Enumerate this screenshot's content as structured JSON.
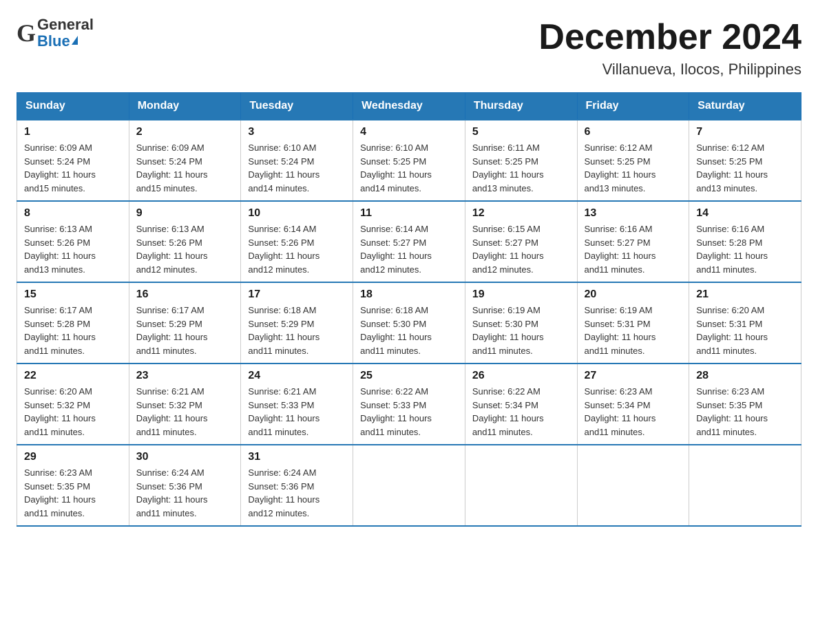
{
  "header": {
    "logo_general": "General",
    "logo_blue": "Blue",
    "month_title": "December 2024",
    "location": "Villanueva, Ilocos, Philippines"
  },
  "weekdays": [
    "Sunday",
    "Monday",
    "Tuesday",
    "Wednesday",
    "Thursday",
    "Friday",
    "Saturday"
  ],
  "weeks": [
    [
      {
        "day": "1",
        "sunrise": "6:09 AM",
        "sunset": "5:24 PM",
        "daylight": "11 hours and 15 minutes."
      },
      {
        "day": "2",
        "sunrise": "6:09 AM",
        "sunset": "5:24 PM",
        "daylight": "11 hours and 15 minutes."
      },
      {
        "day": "3",
        "sunrise": "6:10 AM",
        "sunset": "5:24 PM",
        "daylight": "11 hours and 14 minutes."
      },
      {
        "day": "4",
        "sunrise": "6:10 AM",
        "sunset": "5:25 PM",
        "daylight": "11 hours and 14 minutes."
      },
      {
        "day": "5",
        "sunrise": "6:11 AM",
        "sunset": "5:25 PM",
        "daylight": "11 hours and 13 minutes."
      },
      {
        "day": "6",
        "sunrise": "6:12 AM",
        "sunset": "5:25 PM",
        "daylight": "11 hours and 13 minutes."
      },
      {
        "day": "7",
        "sunrise": "6:12 AM",
        "sunset": "5:25 PM",
        "daylight": "11 hours and 13 minutes."
      }
    ],
    [
      {
        "day": "8",
        "sunrise": "6:13 AM",
        "sunset": "5:26 PM",
        "daylight": "11 hours and 13 minutes."
      },
      {
        "day": "9",
        "sunrise": "6:13 AM",
        "sunset": "5:26 PM",
        "daylight": "11 hours and 12 minutes."
      },
      {
        "day": "10",
        "sunrise": "6:14 AM",
        "sunset": "5:26 PM",
        "daylight": "11 hours and 12 minutes."
      },
      {
        "day": "11",
        "sunrise": "6:14 AM",
        "sunset": "5:27 PM",
        "daylight": "11 hours and 12 minutes."
      },
      {
        "day": "12",
        "sunrise": "6:15 AM",
        "sunset": "5:27 PM",
        "daylight": "11 hours and 12 minutes."
      },
      {
        "day": "13",
        "sunrise": "6:16 AM",
        "sunset": "5:27 PM",
        "daylight": "11 hours and 11 minutes."
      },
      {
        "day": "14",
        "sunrise": "6:16 AM",
        "sunset": "5:28 PM",
        "daylight": "11 hours and 11 minutes."
      }
    ],
    [
      {
        "day": "15",
        "sunrise": "6:17 AM",
        "sunset": "5:28 PM",
        "daylight": "11 hours and 11 minutes."
      },
      {
        "day": "16",
        "sunrise": "6:17 AM",
        "sunset": "5:29 PM",
        "daylight": "11 hours and 11 minutes."
      },
      {
        "day": "17",
        "sunrise": "6:18 AM",
        "sunset": "5:29 PM",
        "daylight": "11 hours and 11 minutes."
      },
      {
        "day": "18",
        "sunrise": "6:18 AM",
        "sunset": "5:30 PM",
        "daylight": "11 hours and 11 minutes."
      },
      {
        "day": "19",
        "sunrise": "6:19 AM",
        "sunset": "5:30 PM",
        "daylight": "11 hours and 11 minutes."
      },
      {
        "day": "20",
        "sunrise": "6:19 AM",
        "sunset": "5:31 PM",
        "daylight": "11 hours and 11 minutes."
      },
      {
        "day": "21",
        "sunrise": "6:20 AM",
        "sunset": "5:31 PM",
        "daylight": "11 hours and 11 minutes."
      }
    ],
    [
      {
        "day": "22",
        "sunrise": "6:20 AM",
        "sunset": "5:32 PM",
        "daylight": "11 hours and 11 minutes."
      },
      {
        "day": "23",
        "sunrise": "6:21 AM",
        "sunset": "5:32 PM",
        "daylight": "11 hours and 11 minutes."
      },
      {
        "day": "24",
        "sunrise": "6:21 AM",
        "sunset": "5:33 PM",
        "daylight": "11 hours and 11 minutes."
      },
      {
        "day": "25",
        "sunrise": "6:22 AM",
        "sunset": "5:33 PM",
        "daylight": "11 hours and 11 minutes."
      },
      {
        "day": "26",
        "sunrise": "6:22 AM",
        "sunset": "5:34 PM",
        "daylight": "11 hours and 11 minutes."
      },
      {
        "day": "27",
        "sunrise": "6:23 AM",
        "sunset": "5:34 PM",
        "daylight": "11 hours and 11 minutes."
      },
      {
        "day": "28",
        "sunrise": "6:23 AM",
        "sunset": "5:35 PM",
        "daylight": "11 hours and 11 minutes."
      }
    ],
    [
      {
        "day": "29",
        "sunrise": "6:23 AM",
        "sunset": "5:35 PM",
        "daylight": "11 hours and 11 minutes."
      },
      {
        "day": "30",
        "sunrise": "6:24 AM",
        "sunset": "5:36 PM",
        "daylight": "11 hours and 11 minutes."
      },
      {
        "day": "31",
        "sunrise": "6:24 AM",
        "sunset": "5:36 PM",
        "daylight": "11 hours and 12 minutes."
      },
      null,
      null,
      null,
      null
    ]
  ],
  "labels": {
    "sunrise": "Sunrise:",
    "sunset": "Sunset:",
    "daylight": "Daylight:"
  }
}
